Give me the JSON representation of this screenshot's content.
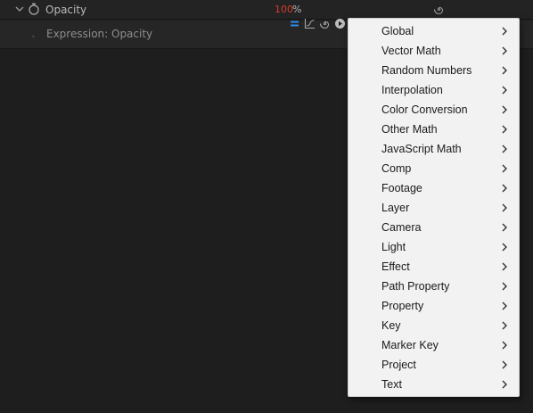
{
  "colors": {
    "panel_bg": "#1e1e1e",
    "value_red": "#d83a2e",
    "accent_blue": "#2d8ceb",
    "menu_bg": "#f2f2f2"
  },
  "property": {
    "label": "Opacity",
    "value": "100",
    "unit": "%",
    "twirl_icon": "chevron-down-icon",
    "stopwatch_icon": "stopwatch-icon",
    "expression_icon": "expression-spiral-icon"
  },
  "expression": {
    "label": "Expression: Opacity",
    "tools": [
      "enable-expression-icon",
      "graph-icon",
      "pick-whip-icon",
      "language-menu-icon"
    ]
  },
  "menu": {
    "items": [
      {
        "label": "Global"
      },
      {
        "label": "Vector Math"
      },
      {
        "label": "Random Numbers"
      },
      {
        "label": "Interpolation"
      },
      {
        "label": "Color Conversion"
      },
      {
        "label": "Other Math"
      },
      {
        "label": "JavaScript Math"
      },
      {
        "label": "Comp"
      },
      {
        "label": "Footage"
      },
      {
        "label": "Layer"
      },
      {
        "label": "Camera"
      },
      {
        "label": "Light"
      },
      {
        "label": "Effect"
      },
      {
        "label": "Path Property"
      },
      {
        "label": "Property"
      },
      {
        "label": "Key"
      },
      {
        "label": "Marker Key"
      },
      {
        "label": "Project"
      },
      {
        "label": "Text"
      }
    ],
    "submenu_icon": "chevron-right-icon"
  }
}
